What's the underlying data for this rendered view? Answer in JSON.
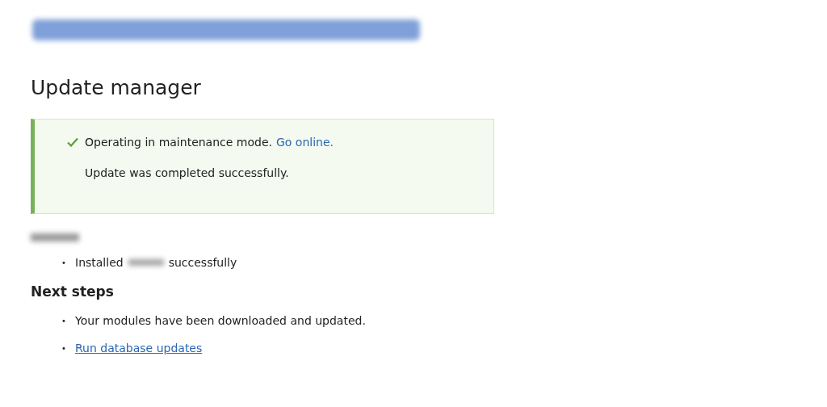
{
  "page_title": "Update manager",
  "messages": [
    {
      "text": "Operating in maintenance mode.",
      "link": "Go online."
    },
    {
      "text": "Update was completed successfully."
    }
  ],
  "installed": {
    "marker": "•",
    "before": "Installed",
    "after": "successfully"
  },
  "next_steps": {
    "heading": "Next steps",
    "items": [
      {
        "kind": "text",
        "marker": "•",
        "text": "Your modules have been downloaded and updated."
      },
      {
        "kind": "link",
        "marker": "•",
        "text": "Run database updates"
      }
    ]
  }
}
